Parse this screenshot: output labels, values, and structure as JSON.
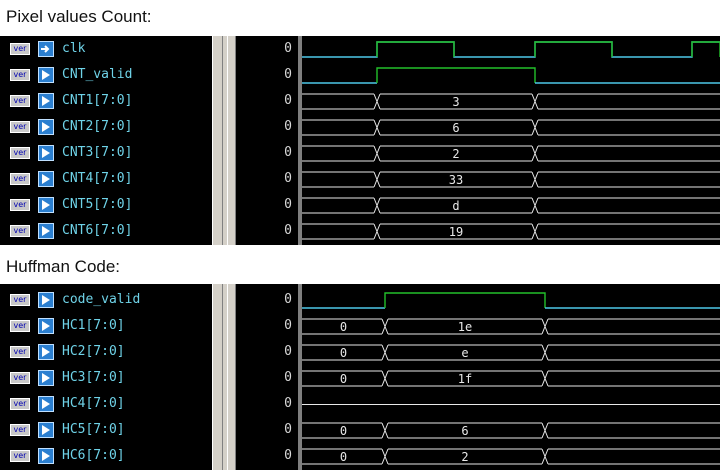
{
  "sections": [
    {
      "title": "Pixel values Count:",
      "signals": [
        {
          "name": "clk",
          "value": "0",
          "port": "input"
        },
        {
          "name": "CNT_valid",
          "value": "0",
          "port": "output"
        },
        {
          "name": "CNT1[7:0]",
          "value": "0",
          "port": "output"
        },
        {
          "name": "CNT2[7:0]",
          "value": "0",
          "port": "output"
        },
        {
          "name": "CNT3[7:0]",
          "value": "0",
          "port": "output"
        },
        {
          "name": "CNT4[7:0]",
          "value": "0",
          "port": "output"
        },
        {
          "name": "CNT5[7:0]",
          "value": "0",
          "port": "output"
        },
        {
          "name": "CNT6[7:0]",
          "value": "0",
          "port": "output"
        }
      ],
      "waves": [
        {
          "type": "clock"
        },
        {
          "type": "bit",
          "segments": [
            {
              "level": 0
            },
            {
              "level": 1
            },
            {
              "level": 0
            }
          ]
        },
        {
          "type": "bus",
          "segments": [
            "",
            "3",
            ""
          ]
        },
        {
          "type": "bus",
          "segments": [
            "",
            "6",
            ""
          ]
        },
        {
          "type": "bus",
          "segments": [
            "",
            "2",
            ""
          ]
        },
        {
          "type": "bus",
          "segments": [
            "",
            "33",
            ""
          ]
        },
        {
          "type": "bus",
          "segments": [
            "",
            "d",
            ""
          ]
        },
        {
          "type": "bus",
          "segments": [
            "",
            "19",
            ""
          ]
        }
      ]
    },
    {
      "title": "Huffman Code:",
      "signals": [
        {
          "name": "code_valid",
          "value": "0",
          "port": "output"
        },
        {
          "name": "HC1[7:0]",
          "value": "0",
          "port": "output"
        },
        {
          "name": "HC2[7:0]",
          "value": "0",
          "port": "output"
        },
        {
          "name": "HC3[7:0]",
          "value": "0",
          "port": "output"
        },
        {
          "name": "HC4[7:0]",
          "value": "0",
          "port": "output"
        },
        {
          "name": "HC5[7:0]",
          "value": "0",
          "port": "output"
        },
        {
          "name": "HC6[7:0]",
          "value": "0",
          "port": "output"
        }
      ],
      "waves": [
        {
          "type": "bit",
          "segments": [
            {
              "level": 0
            },
            {
              "level": 1
            },
            {
              "level": 0
            }
          ]
        },
        {
          "type": "bus",
          "segments": [
            "0",
            "1e",
            ""
          ]
        },
        {
          "type": "bus",
          "segments": [
            "0",
            "e",
            ""
          ]
        },
        {
          "type": "bus",
          "segments": [
            "0",
            "1f",
            ""
          ]
        },
        {
          "type": "flat"
        },
        {
          "type": "bus",
          "segments": [
            "0",
            "6",
            ""
          ]
        },
        {
          "type": "bus",
          "segments": [
            "0",
            "2",
            ""
          ]
        }
      ]
    }
  ],
  "badge": "ver",
  "colors": {
    "signal_name": "#6fd3e8",
    "clock": "#4ec8e8",
    "bit_high": "#22c02a",
    "bus": "#e8e8e8",
    "value": "#d8d8d8"
  }
}
